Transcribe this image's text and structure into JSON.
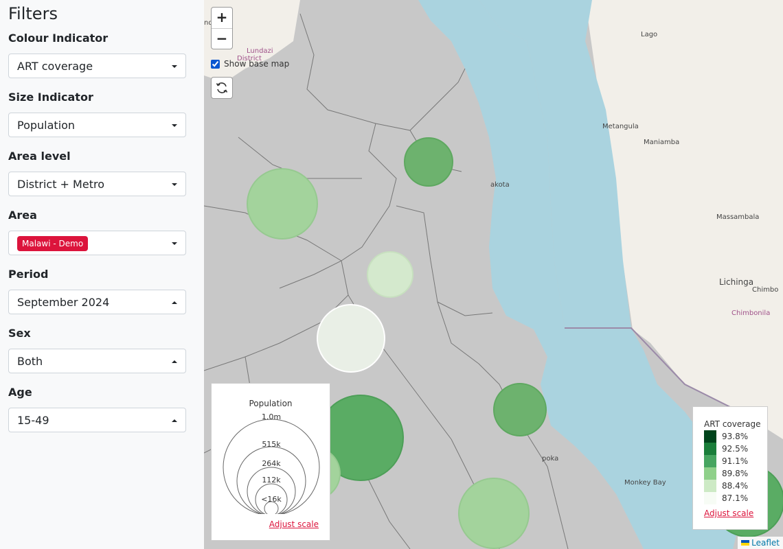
{
  "sidebar": {
    "title": "Filters",
    "filters": [
      {
        "label": "Colour Indicator",
        "value": "ART coverage"
      },
      {
        "label": "Size Indicator",
        "value": "Population"
      },
      {
        "label": "Area level",
        "value": "District + Metro"
      },
      {
        "label": "Area",
        "chip": "Malawi - Demo"
      },
      {
        "label": "Period",
        "value": "September 2024"
      },
      {
        "label": "Sex",
        "value": "Both"
      },
      {
        "label": "Age",
        "value": "15-49"
      }
    ]
  },
  "map": {
    "zoom_in": "+",
    "zoom_out": "−",
    "show_base_map": "Show base map",
    "show_base_map_checked": true,
    "place_labels": [
      "Lago",
      "Lundazi",
      "District",
      "Metangula",
      "Maniamba",
      "Massambala",
      "Lichinga",
      "Chimbo",
      "Chimbonila",
      "akota",
      "poka",
      "Monkey Bay",
      "nd"
    ],
    "attribution": "Leaflet",
    "colors": {
      "water": "#aad3df",
      "land_out": "#f2efe9",
      "areas": "#c8c8c8"
    }
  },
  "size_legend": {
    "title": "Population",
    "labels": [
      "1.0m",
      "515k",
      "264k",
      "112k",
      "<16k"
    ],
    "adjust": "Adjust scale"
  },
  "colour_legend": {
    "title": "ART coverage",
    "items": [
      {
        "label": "93.8%",
        "color": "#00441b"
      },
      {
        "label": "92.5%",
        "color": "#1a7e3a"
      },
      {
        "label": "91.1%",
        "color": "#47a560"
      },
      {
        "label": "89.8%",
        "color": "#8fd08a"
      },
      {
        "label": "88.4%",
        "color": "#cdeac5"
      },
      {
        "label": "87.1%",
        "color": "#f7fcf5"
      }
    ],
    "adjust": "Adjust scale"
  }
}
